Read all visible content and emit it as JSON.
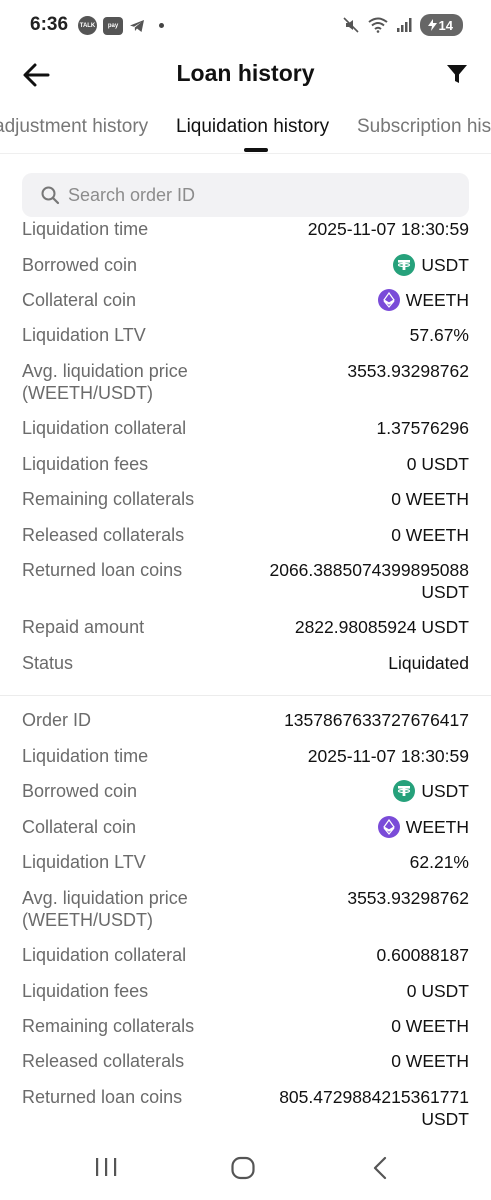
{
  "status_bar": {
    "time": "6:36",
    "talk_label": "TALK",
    "pay_label": "pay",
    "battery": "14",
    "icons": [
      "talk-icon",
      "pay-icon",
      "telegram-icon",
      "mute-icon",
      "wifi-icon",
      "signal-icon",
      "battery-icon"
    ]
  },
  "header": {
    "title": "Loan history"
  },
  "tabs": [
    {
      "label": "adjustment history"
    },
    {
      "label": "Liquidation history",
      "active": true
    },
    {
      "label": "Subscription his"
    }
  ],
  "search": {
    "placeholder": "Search order ID"
  },
  "records": [
    {
      "liquidation_time_label": "Liquidation time",
      "liquidation_time": "2025-11-07 18:30:59",
      "borrowed_coin_label": "Borrowed coin",
      "borrowed_coin": "USDT",
      "collateral_coin_label": "Collateral coin",
      "collateral_coin": "WEETH",
      "ltv_label": "Liquidation LTV",
      "ltv": "57.67%",
      "avg_price_label_1": "Avg. liquidation price",
      "avg_price_label_2": "(WEETH/USDT)",
      "avg_price": "3553.93298762",
      "collateral_label": "Liquidation collateral",
      "collateral": "1.37576296",
      "fees_label": "Liquidation fees",
      "fees": "0 USDT",
      "remaining_label": "Remaining collaterals",
      "remaining": "0 WEETH",
      "released_label": "Released collaterals",
      "released": "0 WEETH",
      "returned_label": "Returned loan coins",
      "returned_1": "2066.3885074399895088",
      "returned_2": "USDT",
      "repaid_label": "Repaid amount",
      "repaid": "2822.98085924 USDT",
      "status_label": "Status",
      "status": "Liquidated"
    },
    {
      "order_id_label": "Order ID",
      "order_id": "1357867633727676417",
      "liquidation_time_label": "Liquidation time",
      "liquidation_time": "2025-11-07 18:30:59",
      "borrowed_coin_label": "Borrowed coin",
      "borrowed_coin": "USDT",
      "collateral_coin_label": "Collateral coin",
      "collateral_coin": "WEETH",
      "ltv_label": "Liquidation LTV",
      "ltv": "62.21%",
      "avg_price_label_1": "Avg. liquidation price",
      "avg_price_label_2": "(WEETH/USDT)",
      "avg_price": "3553.93298762",
      "collateral_label": "Liquidation collateral",
      "collateral": "0.60088187",
      "fees_label": "Liquidation fees",
      "fees": "0 USDT",
      "remaining_label": "Remaining collaterals",
      "remaining": "0 WEETH",
      "released_label": "Released collaterals",
      "released": "0 WEETH",
      "returned_label": "Returned loan coins",
      "returned_1": "805.4729884215361771",
      "returned_2": "USDT"
    }
  ],
  "colors": {
    "usdt": "#26a17b",
    "weeth": "#7a4bd8",
    "label": "#6b6b6b",
    "value": "#111111"
  }
}
